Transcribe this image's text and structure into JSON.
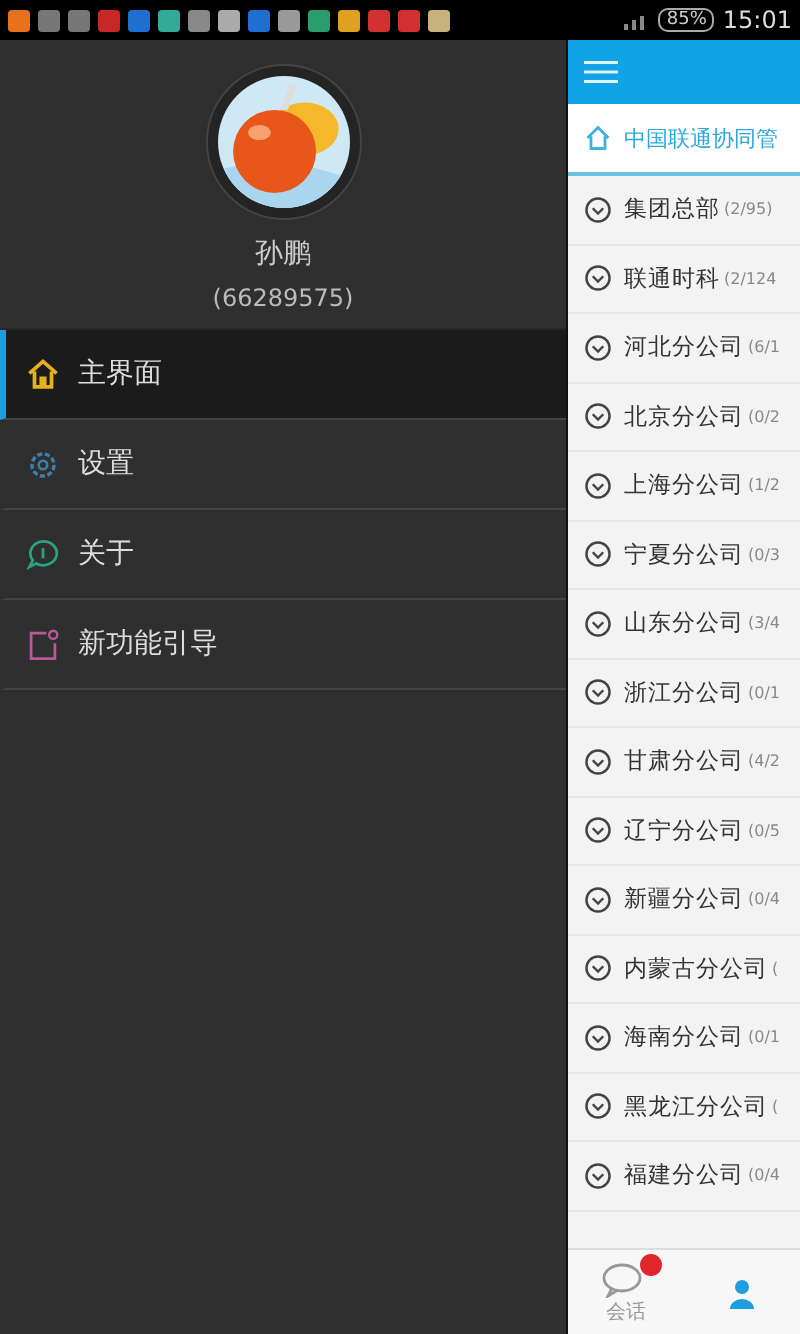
{
  "status_bar": {
    "battery": "85%",
    "time": "15:01"
  },
  "profile": {
    "name": "孙鹏",
    "id": "(66289575)"
  },
  "menu": [
    {
      "kind": "home",
      "label": "主界面",
      "selected": true
    },
    {
      "kind": "settings",
      "label": "设置",
      "selected": false
    },
    {
      "kind": "about",
      "label": "关于",
      "selected": false
    },
    {
      "kind": "guide",
      "label": "新功能引导",
      "selected": false
    }
  ],
  "breadcrumb": "中国联通协同管",
  "groups": [
    {
      "name": "集团总部",
      "count": "(2/95)"
    },
    {
      "name": "联通时科",
      "count": "(2/124"
    },
    {
      "name": "河北分公司",
      "count": "(6/1"
    },
    {
      "name": "北京分公司",
      "count": "(0/2"
    },
    {
      "name": "上海分公司",
      "count": "(1/2"
    },
    {
      "name": "宁夏分公司",
      "count": "(0/3"
    },
    {
      "name": "山东分公司",
      "count": "(3/4"
    },
    {
      "name": "浙江分公司",
      "count": "(0/1"
    },
    {
      "name": "甘肃分公司",
      "count": "(4/2"
    },
    {
      "name": "辽宁分公司",
      "count": "(0/5"
    },
    {
      "name": "新疆分公司",
      "count": "(0/4"
    },
    {
      "name": "内蒙古分公司",
      "count": "("
    },
    {
      "name": "海南分公司",
      "count": "(0/1"
    },
    {
      "name": "黑龙江分公司",
      "count": "("
    },
    {
      "name": "福建分公司",
      "count": "(0/4"
    }
  ],
  "tabs": [
    {
      "kind": "chat",
      "label": "会话",
      "badge": true,
      "selected": false
    },
    {
      "kind": "contacts",
      "selected": true
    }
  ]
}
